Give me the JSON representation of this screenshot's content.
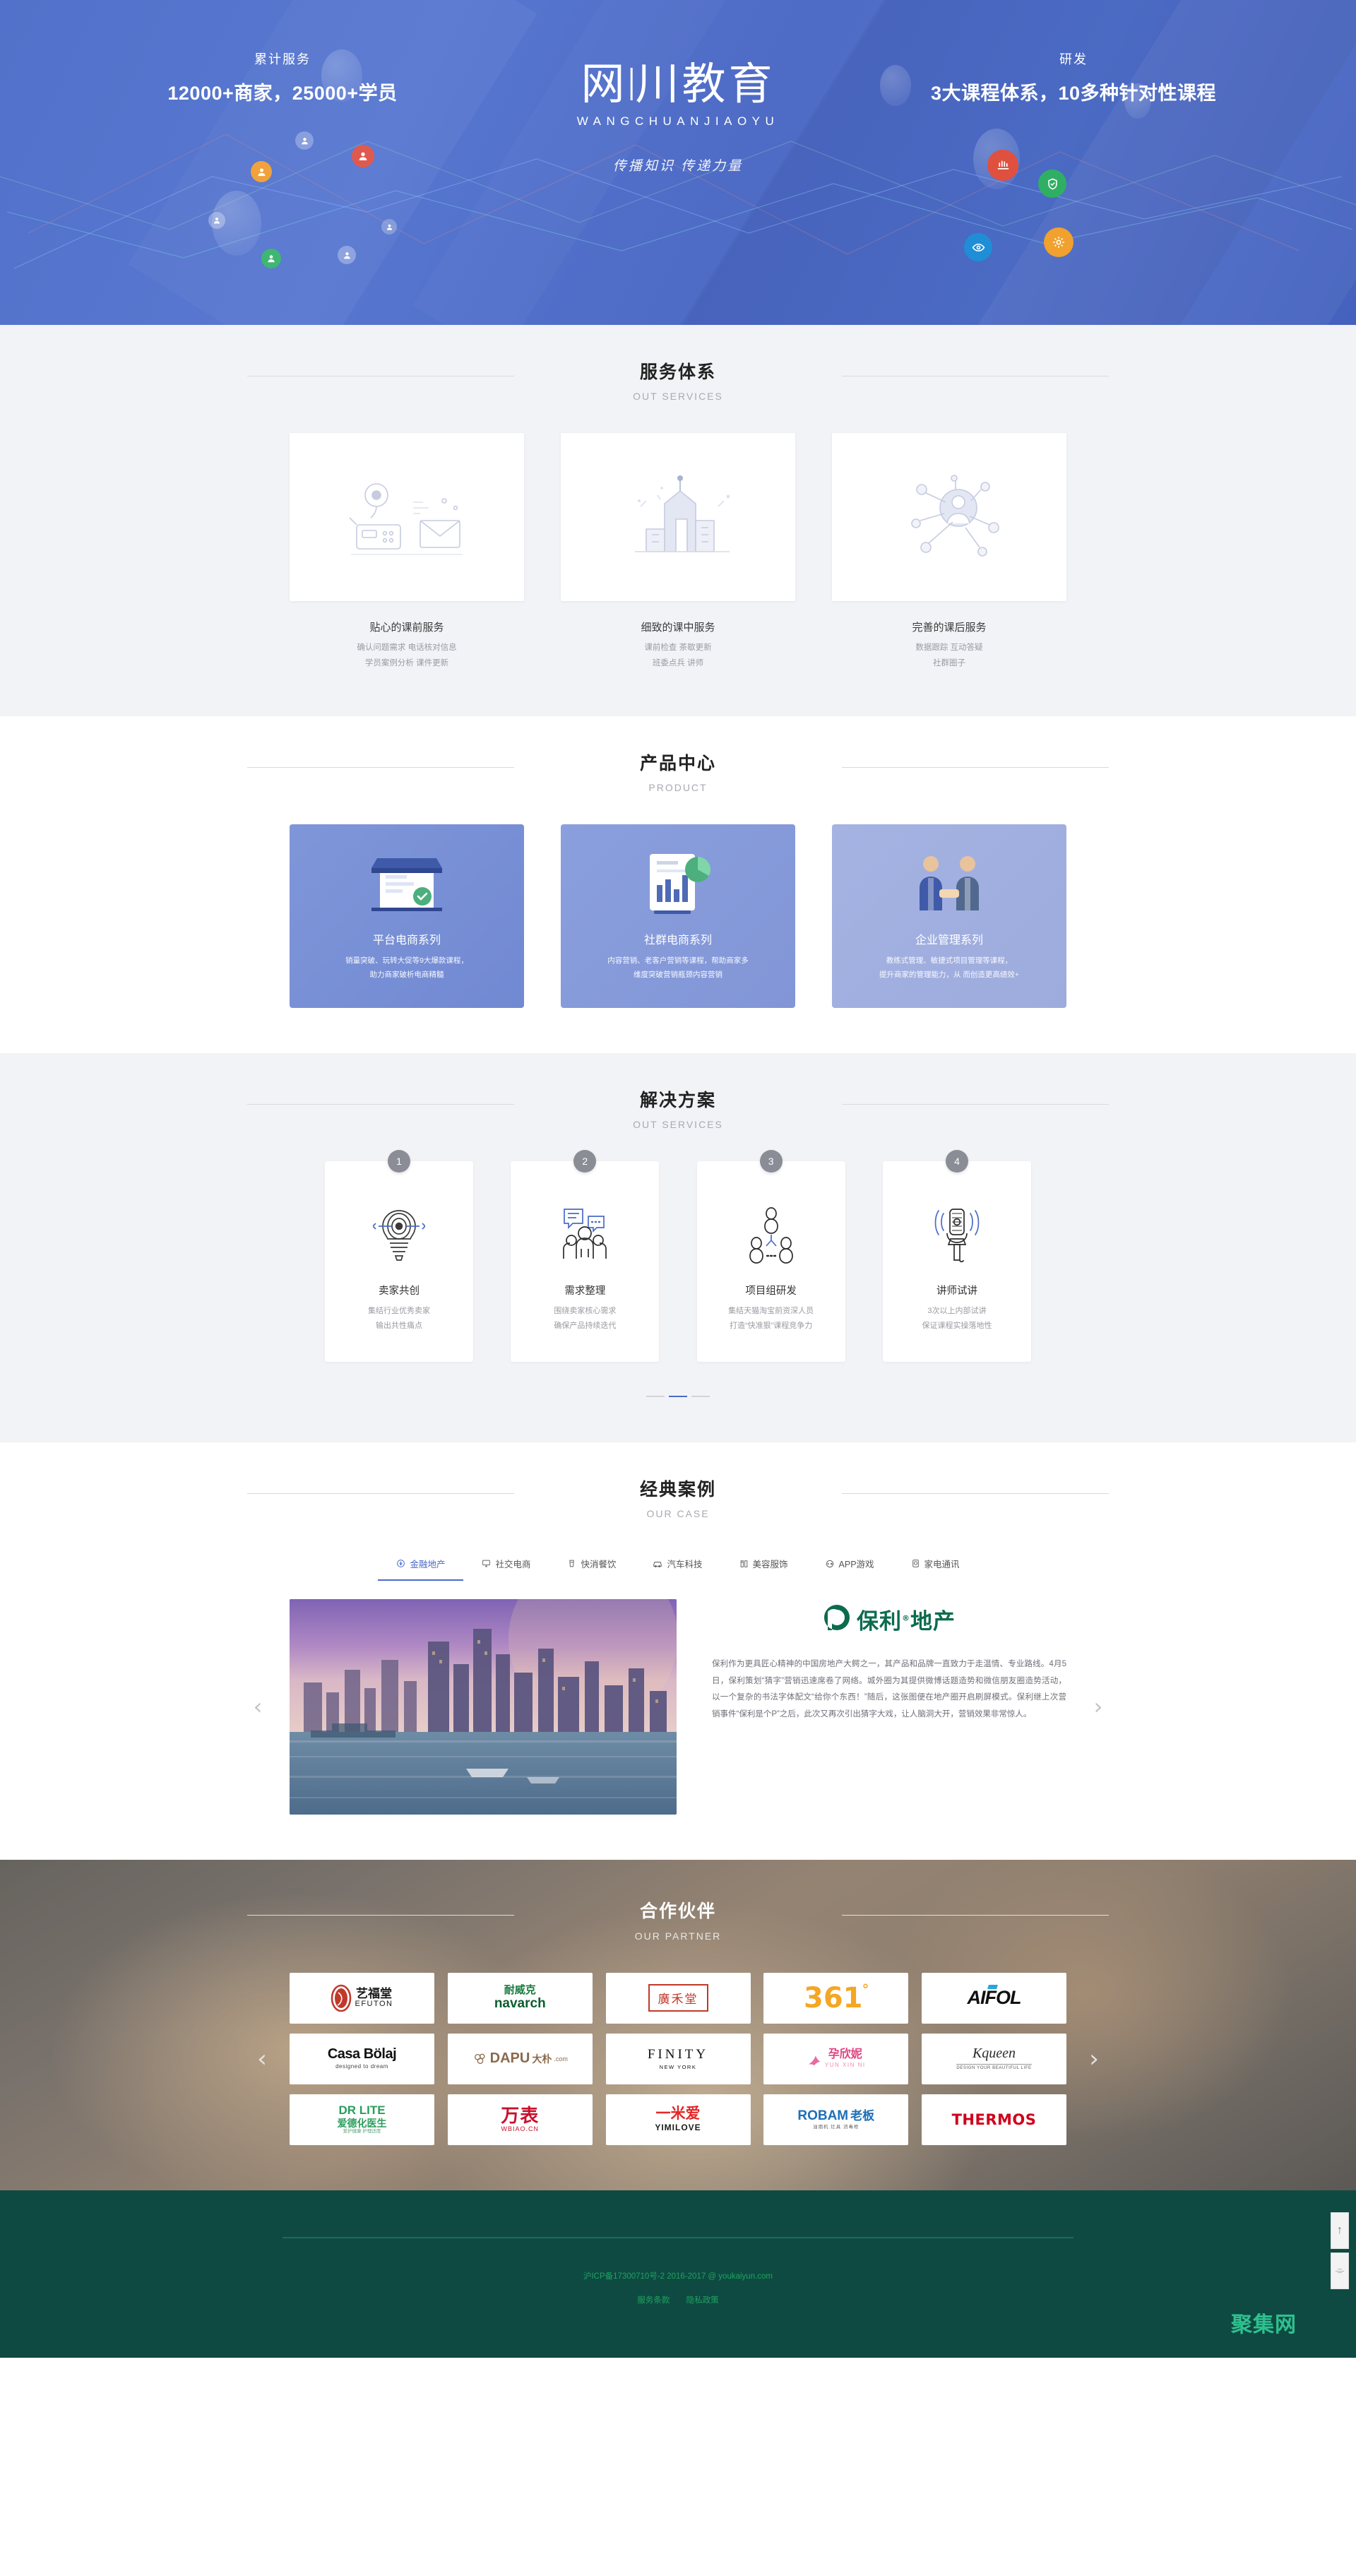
{
  "hero": {
    "logo_cn_a": "网",
    "logo_cn_b": "川教育",
    "logo_en": "WANGCHUANJIAOYU",
    "slogan": "传播知识   传递力量",
    "stat_left_label": "累计服务",
    "stat_left_value": "12000+商家，25000+学员",
    "stat_right_label": "研发",
    "stat_right_value": "3大课程体系，10多种针对性课程"
  },
  "services": {
    "title_cn": "服务体系",
    "title_en": "OUT SERVICES",
    "cards": [
      {
        "title": "贴心的课前服务",
        "line1": "确认问题需求 电话核对信息",
        "line2": "学员案例分析 课件更新",
        "icon": "phone-mail-location-icon"
      },
      {
        "title": "细致的课中服务",
        "line1": "课前检查 茶歇更新",
        "line2": "班委点兵 讲师",
        "icon": "city-buildings-icon"
      },
      {
        "title": "完善的课后服务",
        "line1": "数据跟踪 互动答疑",
        "line2": "社群圈子",
        "icon": "network-person-icon"
      }
    ]
  },
  "product": {
    "title_cn": "产品中心",
    "title_en": "PRODUCT",
    "cards": [
      {
        "title": "平台电商系列",
        "line1": "销量突破、玩转大促等9大爆款课程，",
        "line2": "助力商家破析电商精髓",
        "icon": "storefront-icon"
      },
      {
        "title": "社群电商系列",
        "line1": "内容营销、老客户营销等课程，帮助商家多",
        "line2": "维度突破营销瓶颈内容营销",
        "icon": "dashboard-chart-icon"
      },
      {
        "title": "企业管理系列",
        "line1": "教练式管理、敏捷式项目管理等课程，",
        "line2": "提升商家的管理能力，从 而创造更高绩效+",
        "icon": "handshake-people-icon"
      }
    ]
  },
  "solution": {
    "title_cn": "解决方案",
    "title_en": "OUT SERVICES",
    "cards": [
      {
        "num": "1",
        "title": "卖家共创",
        "line1": "集结行业优秀卖家",
        "line2": "输出共性痛点",
        "icon": "lightbulb-target-icon"
      },
      {
        "num": "2",
        "title": "需求整理",
        "line1": "围绕卖家核心需求",
        "line2": "确保产品持续迭代",
        "icon": "people-chat-icon"
      },
      {
        "num": "3",
        "title": "项目组研发",
        "line1": "集结天猫淘宝前资深人员",
        "line2": "打造“快准狠”课程竞争力",
        "icon": "team-structure-icon"
      },
      {
        "num": "4",
        "title": "讲师试讲",
        "line1": "3次以上内部试讲",
        "line2": "保证课程实操落地性",
        "icon": "microphone-icon"
      }
    ],
    "pager": [
      "0",
      "1",
      "2"
    ],
    "active_page": 1
  },
  "cases": {
    "title_cn": "经典案例",
    "title_en": "OUR CASE",
    "tabs": [
      {
        "label": "金融地产",
        "icon": "finance-icon",
        "active": true
      },
      {
        "label": "社交电商",
        "icon": "monitor-icon",
        "active": false
      },
      {
        "label": "快消餐饮",
        "icon": "cup-icon",
        "active": false
      },
      {
        "label": "汽车科技",
        "icon": "car-icon",
        "active": false
      },
      {
        "label": "美容服饰",
        "icon": "cosmetics-icon",
        "active": false
      },
      {
        "label": "APP游戏",
        "icon": "gamepad-icon",
        "active": false
      },
      {
        "label": "家电通讯",
        "icon": "appliance-icon",
        "active": false
      }
    ],
    "detail": {
      "brand_mark": "P",
      "brand_name": "保利",
      "brand_reg": "®",
      "brand_suffix": "地产",
      "body": "保利作为更具匠心精神的中国房地产大鳄之一，其产品和品牌一直致力于走温情、专业路线。4月5日，保利策划“猜字”营销迅速席卷了网络。城外圈为其提供微博话题造势和微信朋友圈造势活动，以一个复杂的书法字体配文“给你个东西！”随后，这张图便在地产圈开启刷屏模式。保利继上次营销事件“保利是个P”之后，此次又再次引出猜字大戏，让人脑洞大开，营销效果非常惊人。",
      "prev": "‹",
      "next": "›"
    }
  },
  "partners": {
    "title_cn": "合作伙伴",
    "title_en": "OUR PARTNER",
    "prev": "‹",
    "next": "›",
    "rows": [
      [
        {
          "name": "艺福堂 EFUTON",
          "cn": "艺福堂",
          "en": "EFUTON",
          "style": "efuton"
        },
        {
          "name": "耐威克 navarch",
          "cn": "耐威克",
          "en": "navarch",
          "style": "navarch"
        },
        {
          "name": "廣禾堂",
          "cn": "廣禾堂",
          "en": "",
          "style": "guanghetang"
        },
        {
          "name": "361度",
          "cn": "361",
          "en": "°",
          "style": "threesixtyone"
        },
        {
          "name": "AIFOL",
          "cn": "",
          "en": "AIFOL",
          "style": "aifol"
        }
      ],
      [
        {
          "name": "Casa Bolaj",
          "cn": "",
          "en": "Casa Bölaj",
          "sub": "designed to dream",
          "style": "casabolaj"
        },
        {
          "name": "DAPU 大朴",
          "cn": "大朴",
          "en": "DAPU",
          "sub": ".com",
          "style": "dapu"
        },
        {
          "name": "FINITY NEW YORK",
          "cn": "",
          "en": "FINITY",
          "sub": "NEW YORK",
          "style": "finity"
        },
        {
          "name": "孕欣妮 YUN XIN NI",
          "cn": "孕欣妮",
          "en": "YUN XIN NI",
          "style": "yunxinni"
        },
        {
          "name": "Kqueen",
          "cn": "",
          "en": "Kqueen",
          "sub": "DESIGN YOUR BEAUTIFUL LIFE",
          "style": "kqueen"
        }
      ],
      [
        {
          "name": "DR LITE 爱德化医生",
          "cn": "爱德化医生",
          "en": "DR LITE",
          "sub": "爱护健康 护理适度",
          "style": "drlite"
        },
        {
          "name": "万表 WBIAO",
          "cn": "万表",
          "en": "WBIAO.CN",
          "style": "wbiao"
        },
        {
          "name": "一米爱 YIMILOVE",
          "cn": "一米爱",
          "en": "YIMILOVE",
          "style": "yimilove"
        },
        {
          "name": "ROBAM 老板",
          "cn": "老板",
          "en": "ROBAM",
          "sub": "油烟机 灶具 消毒柜",
          "style": "robam"
        },
        {
          "name": "THERMOS",
          "cn": "",
          "en": "THERMOS",
          "style": "thermos"
        }
      ]
    ]
  },
  "footer": {
    "copyright": "沪ICP备17300710号-2 2016-2017 @ youkaiyun.com",
    "link_terms": "服务条款",
    "link_privacy": "隐私政策",
    "watermark": "聚集网",
    "tool_top": "↑",
    "tool_qr": "⌯"
  }
}
